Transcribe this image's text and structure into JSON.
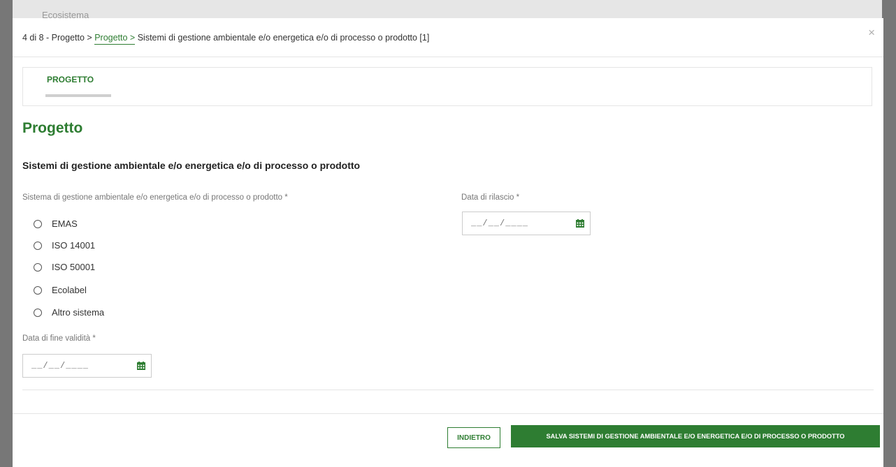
{
  "background": {
    "label": "Ecosistema"
  },
  "breadcrumb": {
    "step": "4 di 8 - Progetto >",
    "link": "Progetto >",
    "current": "Sistemi di gestione ambientale e/o energetica e/o di processo o prodotto [1]"
  },
  "close_glyph": "×",
  "tabs": [
    {
      "label": "PROGETTO"
    }
  ],
  "page_title": "Progetto",
  "section_title": "Sistemi di gestione ambientale e/o energetica e/o di processo o prodotto",
  "system_field": {
    "label": "Sistema di gestione ambientale e/o energetica e/o di processo o prodotto *",
    "options": [
      "EMAS",
      "ISO 14001",
      "ISO 50001",
      "Ecolabel",
      "Altro sistema"
    ],
    "selected": null
  },
  "release_date": {
    "label": "Data di rilascio *",
    "placeholder": "__/__/____",
    "icon": "calendar-icon"
  },
  "expiry_date": {
    "label": "Data di fine validità *",
    "placeholder": "__/__/____",
    "icon": "calendar-icon"
  },
  "buttons": {
    "back": "INDIETRO",
    "save": "SALVA SISTEMI DI GESTIONE AMBIENTALE E/O ENERGETICA E/O DI PROCESSO O PRODOTTO"
  },
  "colors": {
    "accent": "#2e7d32",
    "overlay": "#777777"
  }
}
